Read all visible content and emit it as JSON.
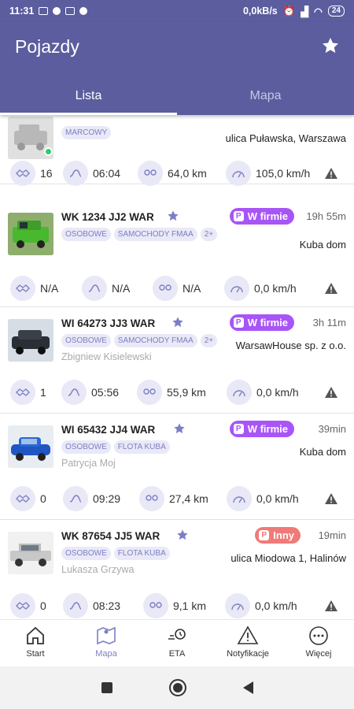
{
  "status_bar": {
    "time": "11:31",
    "network": "0,0kB/s",
    "battery": "24"
  },
  "header": {
    "title": "Pojazdy"
  },
  "tabs": [
    {
      "label": "Lista"
    },
    {
      "label": "Mapa"
    }
  ],
  "vehicles": [
    {
      "plate": "",
      "badge": "",
      "time": "",
      "tags": [
        "MARCOWY"
      ],
      "driver": "",
      "location": "ulica Puławska, Warszawa",
      "stats": {
        "count": "16",
        "duration": "06:04",
        "distance": "64,0 km",
        "speed": "105,0 km/h"
      }
    },
    {
      "plate": "WK 1234 JJ2 WAR",
      "badge": "W firmie",
      "time": "19h 55m",
      "tags": [
        "OSOBOWE",
        "SAMOCHODY FMAA",
        "2+"
      ],
      "driver": "",
      "location": "Kuba dom",
      "stats": {
        "count": "N/A",
        "duration": "N/A",
        "distance": "N/A",
        "speed": "0,0 km/h"
      }
    },
    {
      "plate": "WI 64273 JJ3 WAR",
      "badge": "W firmie",
      "time": "3h 11m",
      "tags": [
        "OSOBOWE",
        "SAMOCHODY FMAA",
        "2+"
      ],
      "driver": "Zbigniew Kisielewski",
      "location": "WarsawHouse sp. z o.o.",
      "stats": {
        "count": "1",
        "duration": "05:56",
        "distance": "55,9 km",
        "speed": "0,0 km/h"
      }
    },
    {
      "plate": "WI 65432 JJ4 WAR",
      "badge": "W firmie",
      "time": "39min",
      "tags": [
        "OSOBOWE",
        "FLOTA KUBA"
      ],
      "driver": "Patrycja Moj",
      "location": "Kuba dom",
      "stats": {
        "count": "0",
        "duration": "09:29",
        "distance": "27,4 km",
        "speed": "0,0 km/h"
      }
    },
    {
      "plate": "WK 87654 JJ5 WAR",
      "badge": "Inny",
      "time": "19min",
      "tags": [
        "OSOBOWE",
        "FLOTA KUBA"
      ],
      "driver": "Lukasza Grzywa",
      "location": "ulica Miodowa 1, Halinów",
      "stats": {
        "count": "0",
        "duration": "08:23",
        "distance": "9,1 km",
        "speed": "0,0 km/h"
      }
    }
  ],
  "bottom_nav": [
    {
      "label": "Start"
    },
    {
      "label": "Mapa"
    },
    {
      "label": "ETA"
    },
    {
      "label": "Notyfikacje"
    },
    {
      "label": "Więcej"
    }
  ],
  "colors": {
    "primary": "#5b5d9e",
    "accent": "#7d7fc4",
    "badge_firm": "#a855f7",
    "badge_other": "#f07a78",
    "online": "#2ecc71"
  }
}
